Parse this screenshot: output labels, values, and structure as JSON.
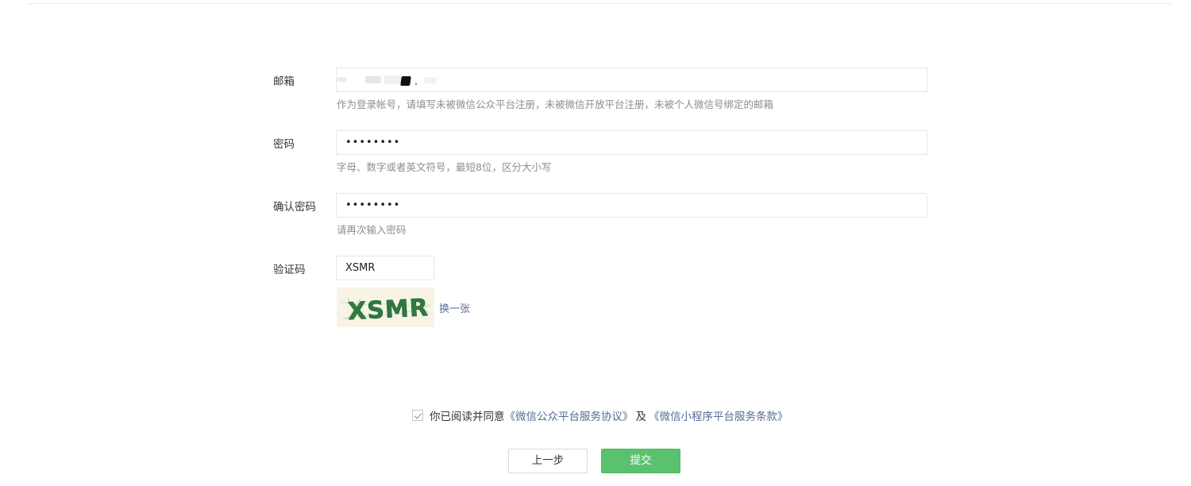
{
  "form": {
    "email": {
      "label": "邮箱",
      "value": "",
      "hint": "作为登录帐号，请填写未被微信公众平台注册，未被微信开放平台注册，未被个人微信号绑定的邮箱"
    },
    "password": {
      "label": "密码",
      "value": "••••••••",
      "hint": "字母、数字或者英文符号，最短8位，区分大小写"
    },
    "confirm_password": {
      "label": "确认密码",
      "value": "••••••••",
      "hint": "请再次输入密码"
    },
    "captcha": {
      "label": "验证码",
      "value": "XSMR",
      "image_text": "XSMR",
      "refresh_label": "换一张"
    }
  },
  "agreement": {
    "checked": true,
    "prefix": "你已阅读并同意",
    "link1": "《微信公众平台服务协议》",
    "conjunction": "及",
    "link2": "《微信小程序平台服务条款》"
  },
  "actions": {
    "prev_label": "上一步",
    "submit_label": "提交"
  },
  "colors": {
    "link": "#576b95",
    "primary": "#5ac26f",
    "hint": "#8d8d8d",
    "border": "#e4e8eb"
  }
}
